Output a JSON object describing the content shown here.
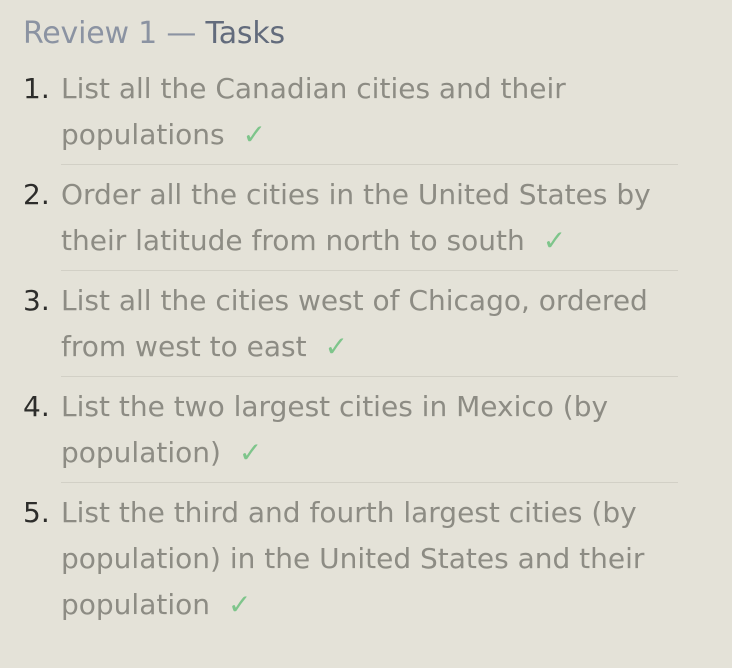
{
  "header": {
    "title_prefix": "Review 1 — ",
    "title_main": "Tasks"
  },
  "tasks": [
    {
      "number": "1.",
      "text": "List all the Canadian cities and their populations",
      "status": "✓"
    },
    {
      "number": "2.",
      "text": "Order all the cities in the United States by their latitude from north to south",
      "status": "✓"
    },
    {
      "number": "3.",
      "text": "List all the cities west of Chicago, ordered from west to east",
      "status": "✓"
    },
    {
      "number": "4.",
      "text": "List the two largest cities in Mexico (by population)",
      "status": "✓"
    },
    {
      "number": "5.",
      "text": "List the third and fourth largest cities (by population) in the United States and their population",
      "status": "✓"
    }
  ],
  "colors": {
    "background": "#e4e2d8",
    "title_muted": "#8b93a2",
    "title_strong": "#626b7c",
    "task_text": "#8d8c84",
    "number_text": "#2d2d2b",
    "checkmark": "#7ec58b",
    "divider": "#d2d0c6"
  },
  "icons": {
    "complete": "checkmark-icon"
  }
}
